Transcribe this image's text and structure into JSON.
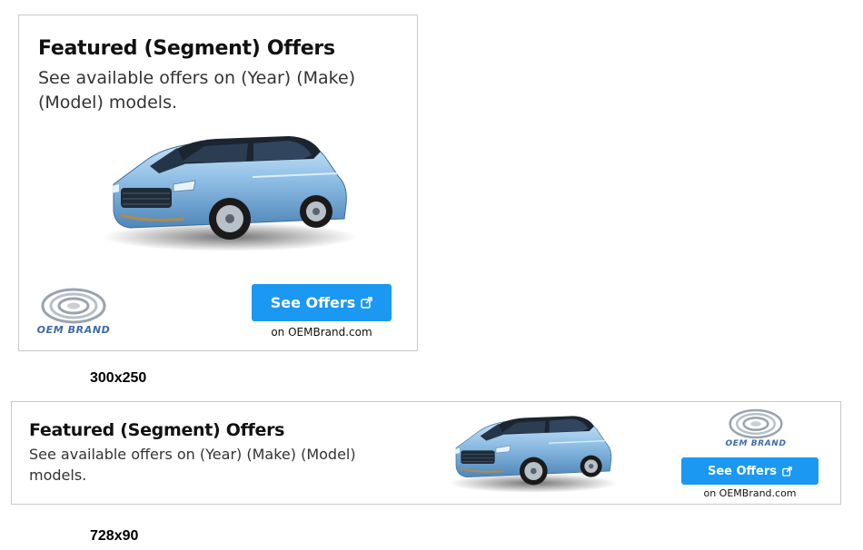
{
  "ads": [
    {
      "headline": "Featured (Segment) Offers",
      "subtext": "See available offers on (Year) (Make) (Model) models.",
      "logo_text": "OEM BRAND",
      "cta_label": "See Offers",
      "cta_icon": "external-link-icon",
      "cta_sub": "on OEMBrand.com",
      "size_label": "300x250"
    },
    {
      "headline": "Featured (Segment) Offers",
      "subtext": "See available offers on (Year) (Make) (Model) models.",
      "logo_text": "OEM BRAND",
      "cta_label": "See Offers",
      "cta_icon": "external-link-icon",
      "cta_sub": "on OEMBrand.com",
      "size_label": "728x90"
    }
  ],
  "colors": {
    "cta_background": "#1a98f2",
    "logo_blue": "#3f6aa8",
    "car_body": "#8fbfe6"
  }
}
